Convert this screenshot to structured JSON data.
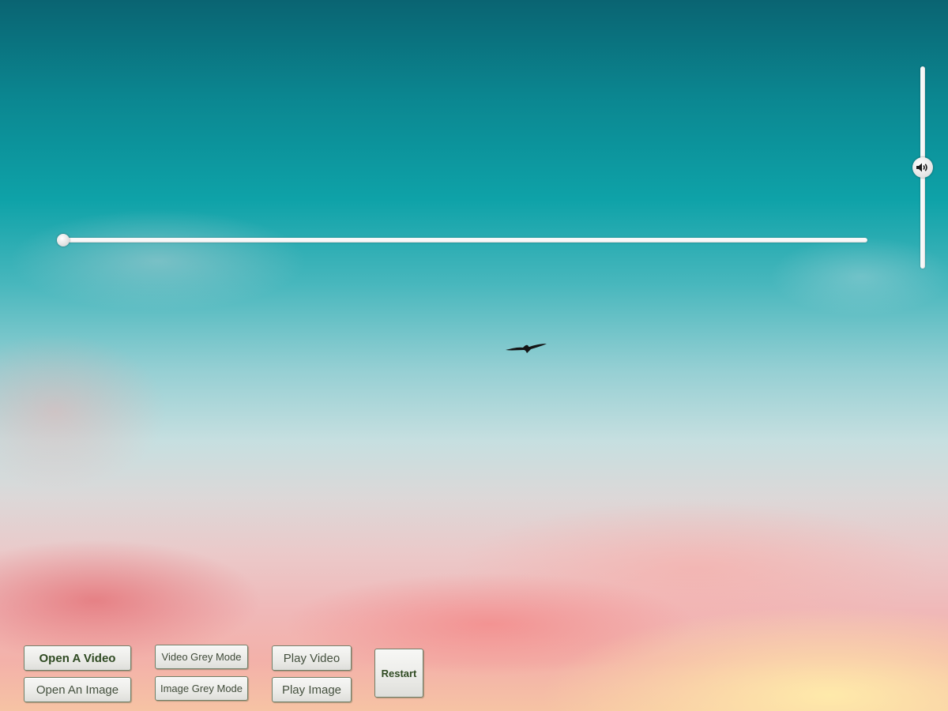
{
  "window": {
    "background": "sky-photo-teal-to-pink-sunset"
  },
  "seek_slider": {
    "value_fraction": 0.0
  },
  "volume_slider": {
    "value_fraction": 0.5,
    "icon": "speaker-volume-icon"
  },
  "buttons": {
    "open_video": "Open A Video",
    "open_image": "Open An Image",
    "video_grey_mode": "Video Grey Mode",
    "image_grey_mode": "Image Grey Mode",
    "play_video": "Play Video",
    "play_image": "Play Image",
    "restart": "Restart"
  },
  "colors": {
    "button_text": "#2f4a22",
    "button_border": "#6f7e66",
    "slider_track": "#f8f8f8"
  }
}
